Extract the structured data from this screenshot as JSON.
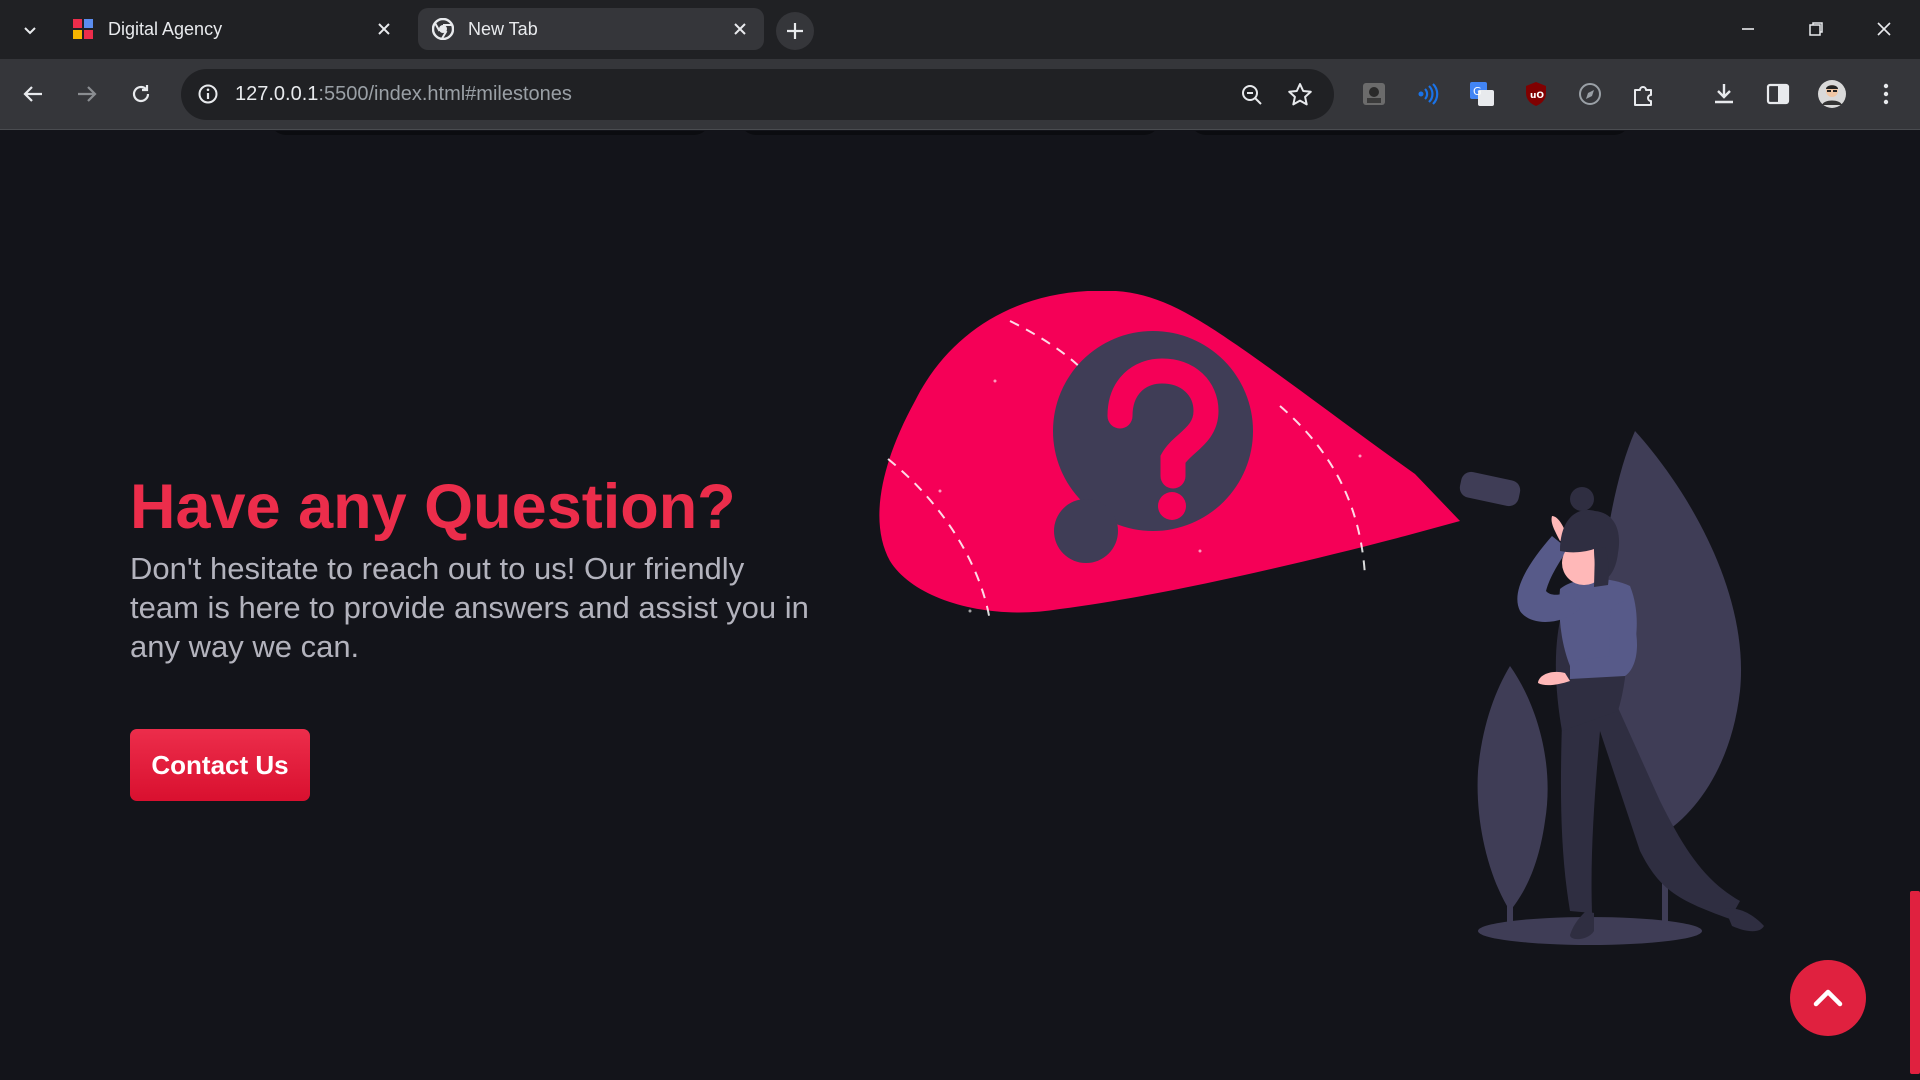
{
  "browser": {
    "tabs": [
      {
        "title": "Digital Agency",
        "active": true
      },
      {
        "title": "New Tab",
        "active": false
      }
    ],
    "url_host": "127.0.0.1",
    "url_path": ":5500/index.html#milestones",
    "colors": {
      "frame": "#202124",
      "toolbar": "#35363a",
      "text": "#e8eaed"
    }
  },
  "section": {
    "title": "Have any Question?",
    "description": "Don't hesitate to reach out to us! Our friendly team is here to provide answers and assist you in any way we can.",
    "button_label": "Contact Us",
    "illustration": "searching-with-flashlight-question-illustration",
    "colors": {
      "accent": "#ec2d4b",
      "background": "#13141a",
      "body_text": "#b3b3bd",
      "illustration_dark": "#3f3d56",
      "illustration_pink": "#f50057"
    }
  },
  "scroll_top": {
    "icon": "chevron-up-icon"
  }
}
